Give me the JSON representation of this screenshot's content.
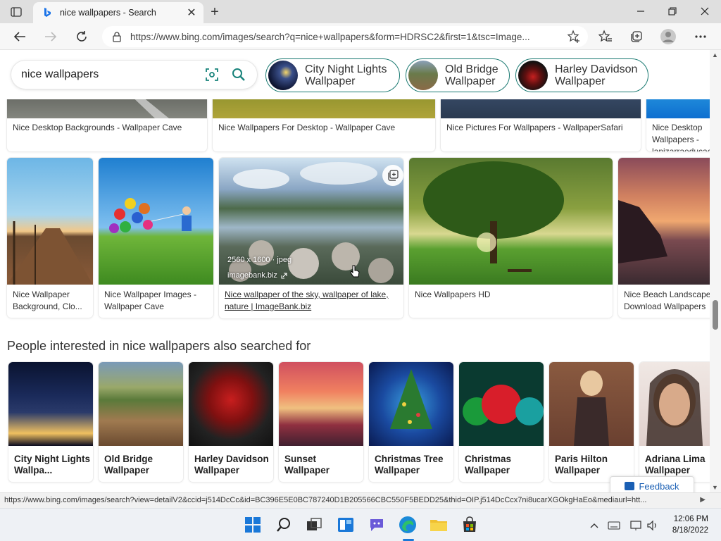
{
  "browser": {
    "tab_title": "nice wallpapers - Search",
    "address_url": "https://www.bing.com/images/search?q=nice+wallpapers&form=HDRSC2&first=1&tsc=Image...",
    "status_url": "https://www.bing.com/images/search?view=detailV2&ccid=j514DcCc&id=BC396E5E0BC787240D1B205566CBC550F5BEDD25&thid=OIP.j514DcCcx7ni8ucarXGOkgHaEo&mediaurl=htt..."
  },
  "search": {
    "query": "nice wallpapers"
  },
  "pills": [
    {
      "label": "City Night Lights Wallpaper"
    },
    {
      "label": "Old Bridge Wallpaper"
    },
    {
      "label": "Harley Davidson Wallpaper"
    }
  ],
  "row1": [
    {
      "caption": "Nice Desktop Backgrounds - Wallpaper Cave"
    },
    {
      "caption": "Nice Wallpapers For Desktop - Wallpaper Cave"
    },
    {
      "caption": "Nice Pictures For Wallpapers - WallpaperSafari"
    },
    {
      "caption": "Nice Desktop Wallpapers - lapizarraeducacion"
    }
  ],
  "row2": [
    {
      "caption": "Nice Wallpaper Background, Clo..."
    },
    {
      "caption": "Nice Wallpaper Images - Wallpaper Cave"
    },
    {
      "caption": "Nice wallpaper of the sky, wallpaper of lake, nature | ImageBank.biz",
      "meta_size": "2560 x 1600 · jpeg",
      "meta_source": "imagebank.biz"
    },
    {
      "caption": "Nice Wallpapers HD"
    },
    {
      "caption": "Nice Beach Landscape Download Wallpapers"
    }
  ],
  "related": {
    "heading": "People interested in nice wallpapers also searched for",
    "items": [
      {
        "label": "City Night Lights Wallpa..."
      },
      {
        "label": "Old Bridge Wallpaper"
      },
      {
        "label": "Harley Davidson Wallpaper"
      },
      {
        "label": "Sunset Wallpaper"
      },
      {
        "label": "Christmas Tree Wallpaper"
      },
      {
        "label": "Christmas Wallpaper"
      },
      {
        "label": "Paris Hilton Wallpaper"
      },
      {
        "label": "Adriana Lima Wallpaper"
      }
    ]
  },
  "feedback_label": "Feedback",
  "clock": {
    "time": "12:06 PM",
    "date": "8/18/2022"
  },
  "colors": {
    "accent_teal": "#1b7a72",
    "bing_blue": "#1a73e8",
    "titlebar": "#dfdfdf"
  }
}
